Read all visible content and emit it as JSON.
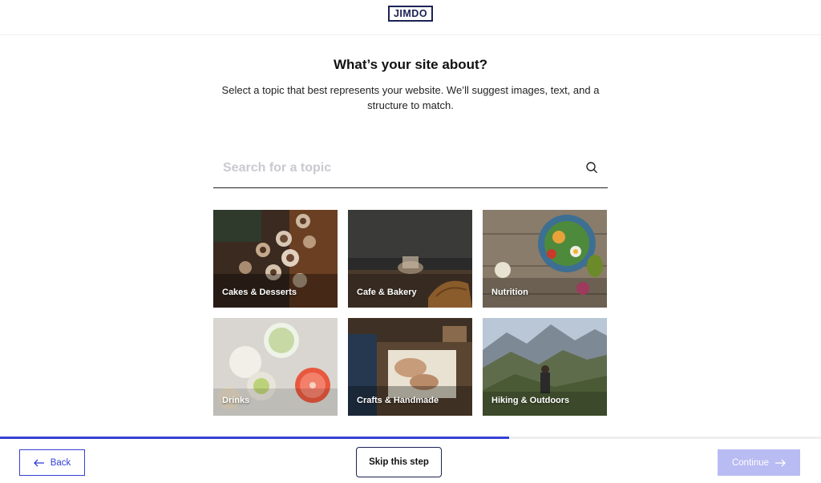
{
  "header": {
    "logo_text": "JIMDO"
  },
  "main": {
    "title": "What’s your site about?",
    "subtitle": "Select a topic that best represents your website. We’ll suggest images, text, and a structure to match."
  },
  "search": {
    "placeholder": "Search for a topic",
    "value": "",
    "icon": "search-icon"
  },
  "topics": [
    {
      "label": "Cakes & Desserts"
    },
    {
      "label": "Cafe & Bakery"
    },
    {
      "label": "Nutrition"
    },
    {
      "label": "Drinks"
    },
    {
      "label": "Crafts & Handmade"
    },
    {
      "label": "Hiking & Outdoors"
    }
  ],
  "progress": {
    "fraction": 0.62,
    "color": "#3440d4"
  },
  "footer": {
    "back_label": "Back",
    "skip_label": "Skip this step",
    "continue_label": "Continue"
  }
}
